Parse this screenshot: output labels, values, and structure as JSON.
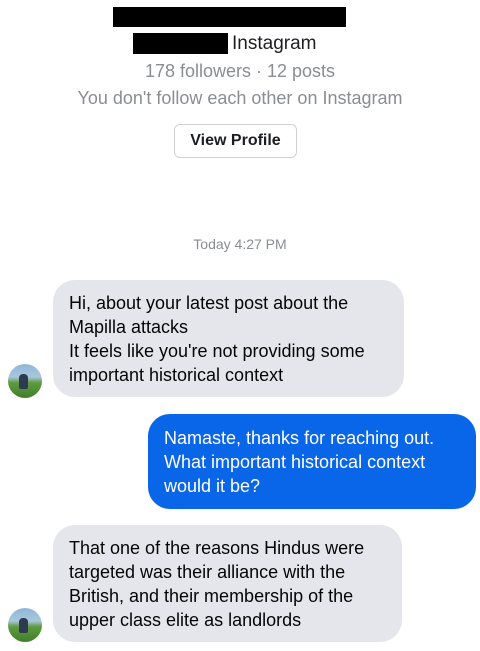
{
  "header": {
    "platform": "Instagram",
    "stats": "178 followers · 12 posts",
    "mutual": "You don't follow each other on Instagram",
    "view_profile_label": "View Profile"
  },
  "thread": {
    "timestamp": "Today 4:27 PM",
    "messages": [
      {
        "sender": "other",
        "text": "Hi, about your latest post about the Mapilla attacks\nIt feels like you're not providing some important historical context"
      },
      {
        "sender": "me",
        "text": "Namaste, thanks for reaching out. What important historical context would it be?"
      },
      {
        "sender": "other",
        "text": "That one of the reasons Hindus were targeted was their alliance with the British, and their membership of the upper class elite as landlords"
      }
    ]
  },
  "colors": {
    "outgoing_bubble": "#0a66e8",
    "incoming_bubble": "#e4e6eb",
    "secondary_text": "#8a8d91"
  }
}
